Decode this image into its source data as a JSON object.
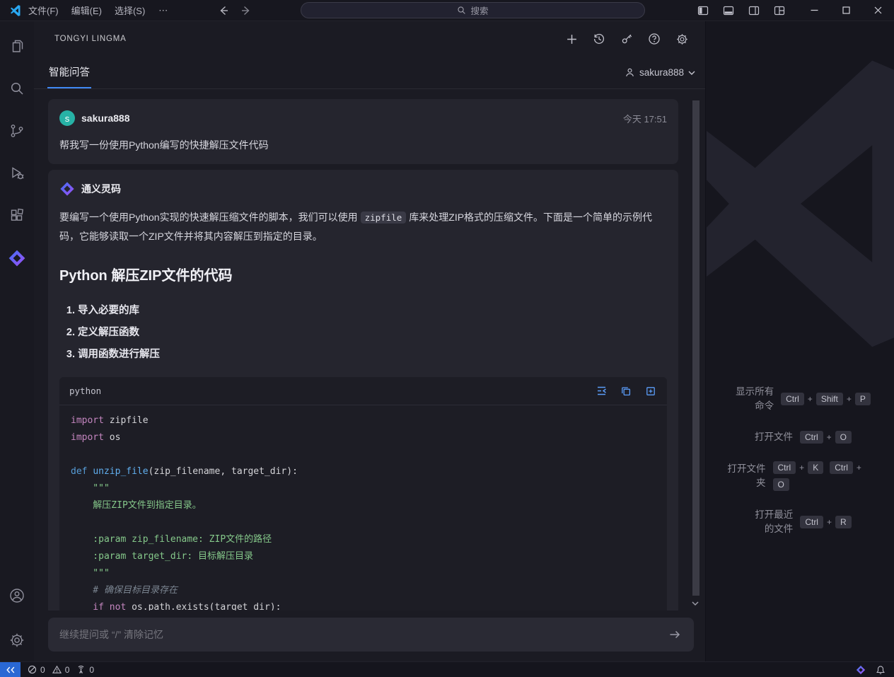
{
  "colors": {
    "accent_blue": "#4088f4",
    "avatar_teal": "#27b2a6",
    "logo_gradient_start": "#3f6ff5",
    "logo_gradient_end": "#a04ff5",
    "remote_blue": "#2968d4",
    "code_keyword": "#c586c0",
    "code_def": "#569cd6",
    "code_function": "#61afef",
    "code_string": "#85c88a",
    "code_comment": "#7a8490"
  },
  "title_bar": {
    "menus": [
      "文件(F)",
      "编辑(E)",
      "选择(S)"
    ],
    "more_label": "⋯",
    "search_placeholder": "搜索"
  },
  "panel": {
    "title": "TONGYI LINGMA",
    "tab_label": "智能问答",
    "account_name": "sakura888",
    "user_message": {
      "avatar_letter": "s",
      "name": "sakura888",
      "time": "今天 17:51",
      "text": "帮我写一份使用Python编写的快捷解压文件代码"
    },
    "ai_message": {
      "name": "通义灵码",
      "intro_before": "要编写一个使用Python实现的快速解压缩文件的脚本，我们可以使用",
      "inline_code": "zipfile",
      "intro_after": "库来处理ZIP格式的压缩文件。下面是一个简单的示例代码，它能够读取一个ZIP文件并将其内容解压到指定的目录。",
      "heading": "Python 解压ZIP文件的代码",
      "steps": [
        "导入必要的库",
        "定义解压函数",
        "调用函数进行解压"
      ],
      "code": {
        "lang": "python",
        "lines": [
          [
            {
              "c": "kw",
              "t": "import"
            },
            {
              "c": "pl",
              "t": " zipfile"
            }
          ],
          [
            {
              "c": "kw",
              "t": "import"
            },
            {
              "c": "pl",
              "t": " os"
            }
          ],
          [],
          [
            {
              "c": "def",
              "t": "def"
            },
            {
              "c": "pl",
              "t": " "
            },
            {
              "c": "fn",
              "t": "unzip_file"
            },
            {
              "c": "pl",
              "t": "(zip_filename, target_dir):"
            }
          ],
          [
            {
              "c": "str",
              "t": "    \"\"\""
            }
          ],
          [
            {
              "c": "str",
              "t": "    解压ZIP文件到指定目录。"
            }
          ],
          [],
          [
            {
              "c": "str",
              "t": "    :param zip_filename: ZIP文件的路径"
            }
          ],
          [
            {
              "c": "str",
              "t": "    :param target_dir: 目标解压目录"
            }
          ],
          [
            {
              "c": "str",
              "t": "    \"\"\""
            }
          ],
          [
            {
              "c": "com",
              "t": "    # 确保目标目录存在"
            }
          ],
          [
            {
              "c": "kw",
              "t": "    if"
            },
            {
              "c": "pl",
              "t": " "
            },
            {
              "c": "kw",
              "t": "not"
            },
            {
              "c": "pl",
              "t": " os.path.exists(target_dir):"
            }
          ]
        ]
      }
    },
    "input_placeholder": "继续提问或 “/” 清除记忆"
  },
  "editor": {
    "shortcuts": [
      {
        "label": "显示所有命令",
        "chords": [
          [
            "Ctrl",
            "Shift",
            "P"
          ]
        ]
      },
      {
        "label": "打开文件",
        "chords": [
          [
            "Ctrl",
            "O"
          ]
        ]
      },
      {
        "label": "打开文件夹",
        "chords": [
          [
            "Ctrl",
            "K"
          ],
          [
            "Ctrl",
            "O"
          ]
        ]
      },
      {
        "label": "打开最近的文件",
        "chords": [
          [
            "Ctrl",
            "R"
          ]
        ]
      }
    ]
  },
  "status_bar": {
    "errors": "0",
    "warnings": "0",
    "ports": "0"
  }
}
